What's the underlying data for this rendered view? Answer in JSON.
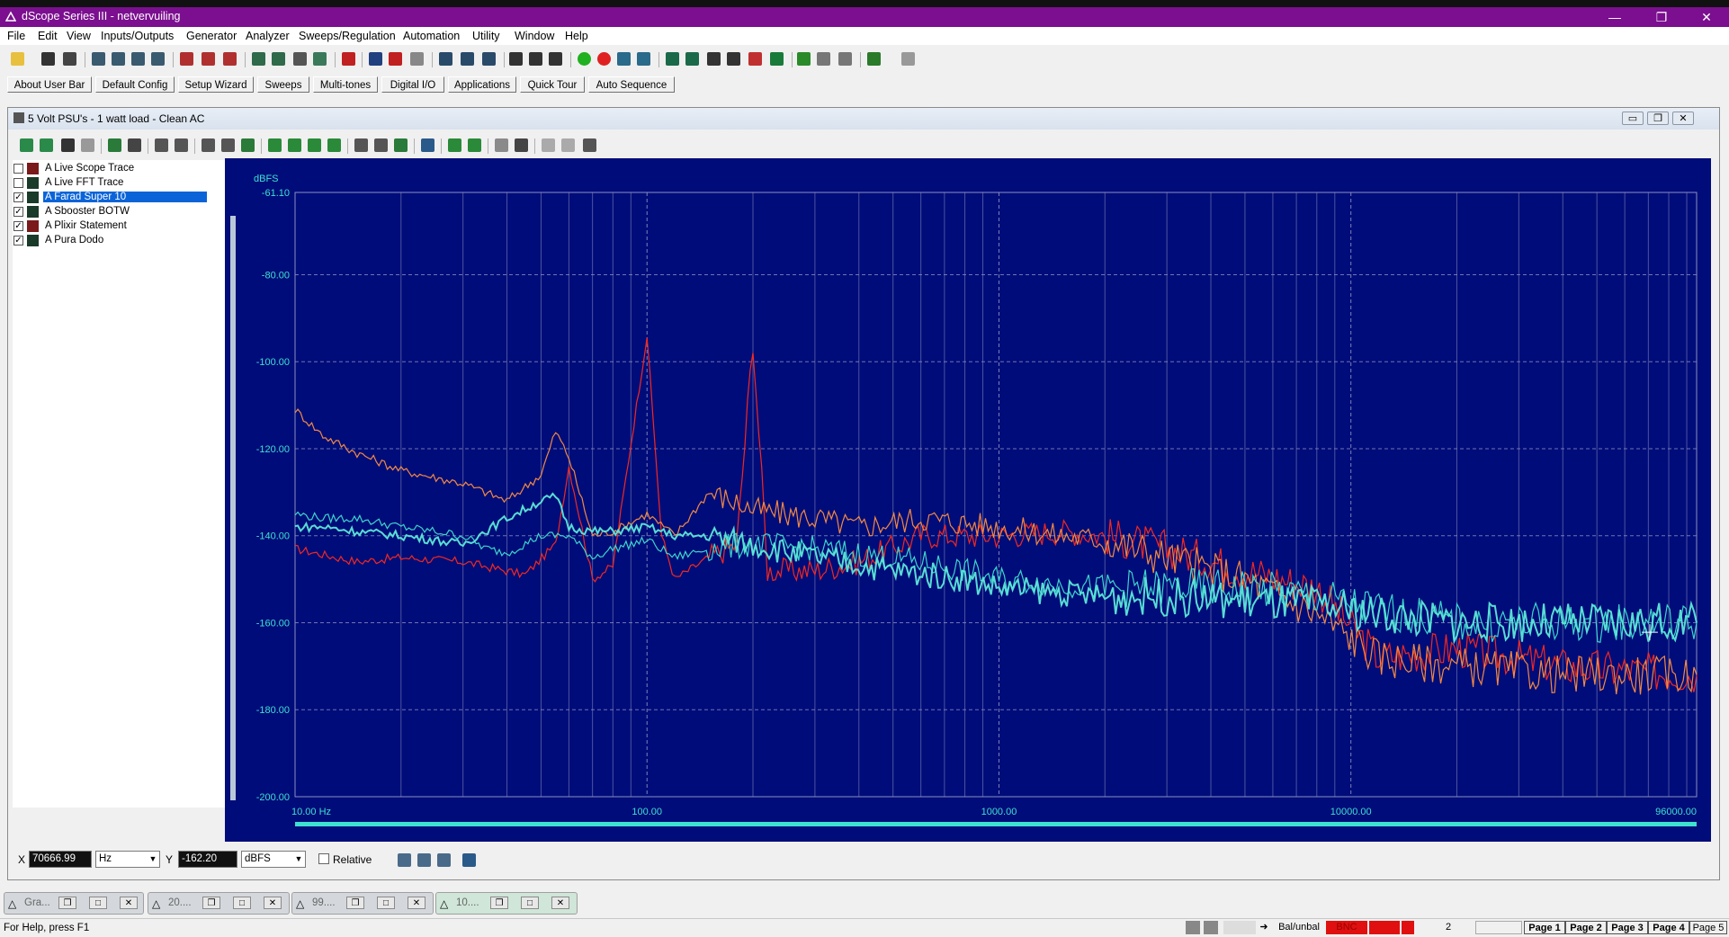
{
  "window": {
    "title": "dScope Series III - netvervuiling",
    "minimize": "—",
    "restore": "❐",
    "close": "✕"
  },
  "menu": [
    "File",
    "Edit",
    "View",
    "Inputs/Outputs",
    "Generator",
    "Analyzer",
    "Sweeps/Regulation",
    "Automation",
    "Utility",
    "Window",
    "Help"
  ],
  "user_bar": [
    "About User Bar",
    "Default Config",
    "Setup Wizard",
    "Sweeps",
    "Multi-tones",
    "Digital I/O",
    "Applications",
    "Quick Tour",
    "Auto Sequence"
  ],
  "graph_window": {
    "title": "5 Volt PSU's - 1 watt load - Clean AC"
  },
  "traces": [
    {
      "label": "A  Live Scope Trace",
      "checked": false,
      "selected": false
    },
    {
      "label": "A  Live FFT Trace",
      "checked": false,
      "selected": false
    },
    {
      "label": "A  Farad Super 10",
      "checked": true,
      "selected": true
    },
    {
      "label": "A  Sbooster BOTW",
      "checked": true,
      "selected": false
    },
    {
      "label": "A  Plixir Statement",
      "checked": true,
      "selected": false
    },
    {
      "label": "A  Pura Dodo",
      "checked": true,
      "selected": false
    }
  ],
  "chart_data": {
    "type": "line",
    "ylabel": "dBFS",
    "x_scale": "log",
    "xlim": [
      10,
      96000
    ],
    "ylim": [
      -200,
      -61.1
    ],
    "x_ticks": [
      "10.00 Hz",
      "100.00",
      "1000.00",
      "10000.00",
      "96000.00"
    ],
    "y_ticks": [
      "-61.10",
      "-80.00",
      "-100.00",
      "-120.00",
      "-140.00",
      "-160.00",
      "-180.00",
      "-200.00"
    ],
    "grid": true,
    "colors": {
      "background": "#000c7a",
      "grid": "#8a90c0",
      "label": "#3ee0d0"
    },
    "series": [
      {
        "name": "A  Farad Super 10",
        "color": "#ff2a1a",
        "x": [
          10,
          15,
          20,
          30,
          45,
          55,
          60,
          70,
          80,
          95,
          100,
          110,
          120,
          150,
          180,
          200,
          220,
          300,
          400,
          600,
          1000,
          1500,
          2000,
          3000,
          5000,
          8000,
          12000,
          20000,
          40000,
          96000
        ],
        "y": [
          -143,
          -146,
          -145,
          -146,
          -149,
          -142,
          -124,
          -150,
          -147,
          -106,
          -94,
          -140,
          -150,
          -145,
          -142,
          -95,
          -148,
          -148,
          -146,
          -140,
          -140,
          -139,
          -140,
          -143,
          -148,
          -152,
          -168,
          -166,
          -170,
          -172
        ]
      },
      {
        "name": "A  Sbooster BOTW",
        "color": "#ff9040",
        "x": [
          10,
          12,
          15,
          20,
          30,
          40,
          50,
          55,
          60,
          70,
          80,
          100,
          120,
          150,
          200,
          300,
          400,
          600,
          1000,
          1500,
          2000,
          3000,
          5000,
          8000,
          12000,
          20000,
          40000,
          96000
        ],
        "y": [
          -111,
          -117,
          -121,
          -125,
          -128,
          -132,
          -126,
          -116,
          -122,
          -140,
          -139,
          -135,
          -140,
          -130,
          -134,
          -136,
          -138,
          -136,
          -138,
          -140,
          -141,
          -145,
          -150,
          -158,
          -168,
          -170,
          -172,
          -172
        ]
      },
      {
        "name": "A  Plixir Statement",
        "color": "#40e0d0",
        "x": [
          10,
          12,
          15,
          20,
          25,
          30,
          35,
          40,
          50,
          60,
          70,
          80,
          100,
          120,
          150,
          200,
          300,
          500,
          800,
          1000,
          2000,
          3000,
          5000,
          8000,
          12000,
          20000,
          40000,
          96000
        ],
        "y": [
          -135,
          -136,
          -136,
          -138,
          -139,
          -140,
          -143,
          -144,
          -140,
          -140,
          -145,
          -143,
          -141,
          -145,
          -143,
          -142,
          -143,
          -145,
          -148,
          -150,
          -152,
          -152,
          -152,
          -154,
          -157,
          -160,
          -160,
          -160
        ]
      },
      {
        "name": "A  Pura Dodo",
        "color": "#5ee8d8",
        "x": [
          10,
          12,
          15,
          20,
          25,
          30,
          40,
          50,
          55,
          60,
          70,
          80,
          100,
          120,
          150,
          200,
          300,
          500,
          800,
          1000,
          2000,
          3000,
          5000,
          8000,
          12000,
          20000,
          40000,
          96000
        ],
        "y": [
          -138,
          -138,
          -139,
          -140,
          -141,
          -142,
          -136,
          -132,
          -131,
          -138,
          -139,
          -139,
          -138,
          -140,
          -140,
          -142,
          -145,
          -148,
          -150,
          -152,
          -154,
          -154,
          -155,
          -156,
          -158,
          -160,
          -160,
          -160
        ]
      }
    ]
  },
  "cursor": {
    "x_label": "X",
    "x_value": "70666.99",
    "x_unit": "Hz",
    "y_label": "Y",
    "y_value": "-162.20",
    "y_unit": "dBFS",
    "relative_label": "Relative"
  },
  "tasks": [
    {
      "label": "Gra...",
      "active": false
    },
    {
      "label": "20....",
      "active": false
    },
    {
      "label": "99....",
      "active": false
    },
    {
      "label": "10....",
      "active": true
    }
  ],
  "status": {
    "help": "For Help, press F1",
    "bal_unbal": "Bal/unbal",
    "bnc": "BNC",
    "count": "2",
    "pages": [
      "Page 1",
      "Page 2",
      "Page 3",
      "Page 4",
      "Page 5"
    ]
  }
}
